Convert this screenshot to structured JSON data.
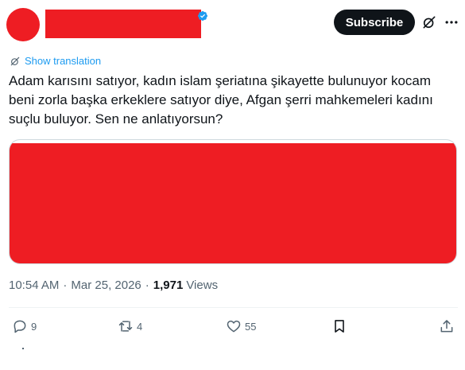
{
  "header": {
    "subscribe_label": "Subscribe"
  },
  "translation": {
    "label": "Show translation"
  },
  "tweet": {
    "text": "Adam karısını satıyor, kadın islam şeriatına şikayette bulunuyor kocam\nbeni zorla başka erkeklere satıyor diye, Afgan şerri mahkemeleri kadını\nsuçlu buluyor. Sen ne anlatıyorsun?"
  },
  "meta": {
    "time": "10:54 AM",
    "separator": "·",
    "date": "Mar 25, 2026",
    "views_count": "1,971",
    "views_label": "Views"
  },
  "actions": {
    "replies": "9",
    "reposts": "4",
    "likes": "55"
  },
  "colors": {
    "redaction": "#ee1d23",
    "accent": "#1d9bf0",
    "muted": "#536471",
    "text": "#0f1419"
  },
  "icons": [
    "verified-badge-icon",
    "grok-icon",
    "more-icon",
    "translate-icon",
    "reply-icon",
    "repost-icon",
    "like-icon",
    "bookmark-icon",
    "share-icon"
  ]
}
